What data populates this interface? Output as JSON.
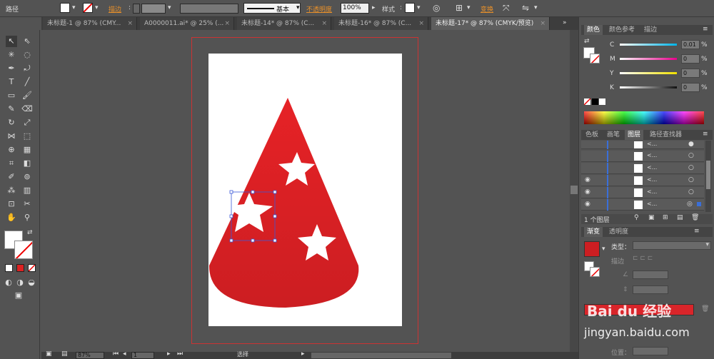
{
  "control_bar": {
    "object_type": "路径",
    "stroke_label": "描边",
    "stroke_style": "基本",
    "opacity_label": "不透明度",
    "opacity_value": "100%",
    "style_label": "样式",
    "transform_label": "变换"
  },
  "tabs": [
    {
      "label": "未标题-1 @ 87% (CMY..."
    },
    {
      "label": "A0000011.ai* @ 25% (..."
    },
    {
      "label": "未标题-14* @ 87% (C..."
    },
    {
      "label": "未标题-16* @ 87% (C..."
    },
    {
      "label": "未标题-17* @ 87% (CMYK/预览)",
      "active": true
    }
  ],
  "color_panel": {
    "tabs": [
      "颜色",
      "颜色参考",
      "描边"
    ],
    "channels": [
      {
        "name": "C",
        "value": "0.01",
        "unit": "%",
        "color": "#00b4e8"
      },
      {
        "name": "M",
        "value": "0",
        "unit": "%",
        "color": "#e8008c"
      },
      {
        "name": "Y",
        "value": "0",
        "unit": "%",
        "color": "#f0e000"
      },
      {
        "name": "K",
        "value": "0",
        "unit": "%",
        "color": "#222222"
      }
    ]
  },
  "layers_panel": {
    "tabs": [
      "色板",
      "画笔",
      "图层",
      "路径查找器"
    ],
    "rows": [
      {
        "label": "<..."
      },
      {
        "label": "<..."
      },
      {
        "label": "<..."
      },
      {
        "label": "<..."
      },
      {
        "label": "<..."
      },
      {
        "label": "<..."
      }
    ],
    "footer": "1 个图层"
  },
  "gradient_panel": {
    "tabs": [
      "渐变",
      "透明度"
    ],
    "type_label": "类型：",
    "stroke_label": "描边",
    "position_label": "位置："
  },
  "status_bar": {
    "zoom": "87%",
    "page": "1",
    "mode": "选择"
  },
  "watermark": {
    "line1": "Bai du 经验",
    "line2": "jingyan.baidu.com"
  },
  "colors": {
    "fill_red": "#e01e1e",
    "accent": "#d9252a"
  }
}
